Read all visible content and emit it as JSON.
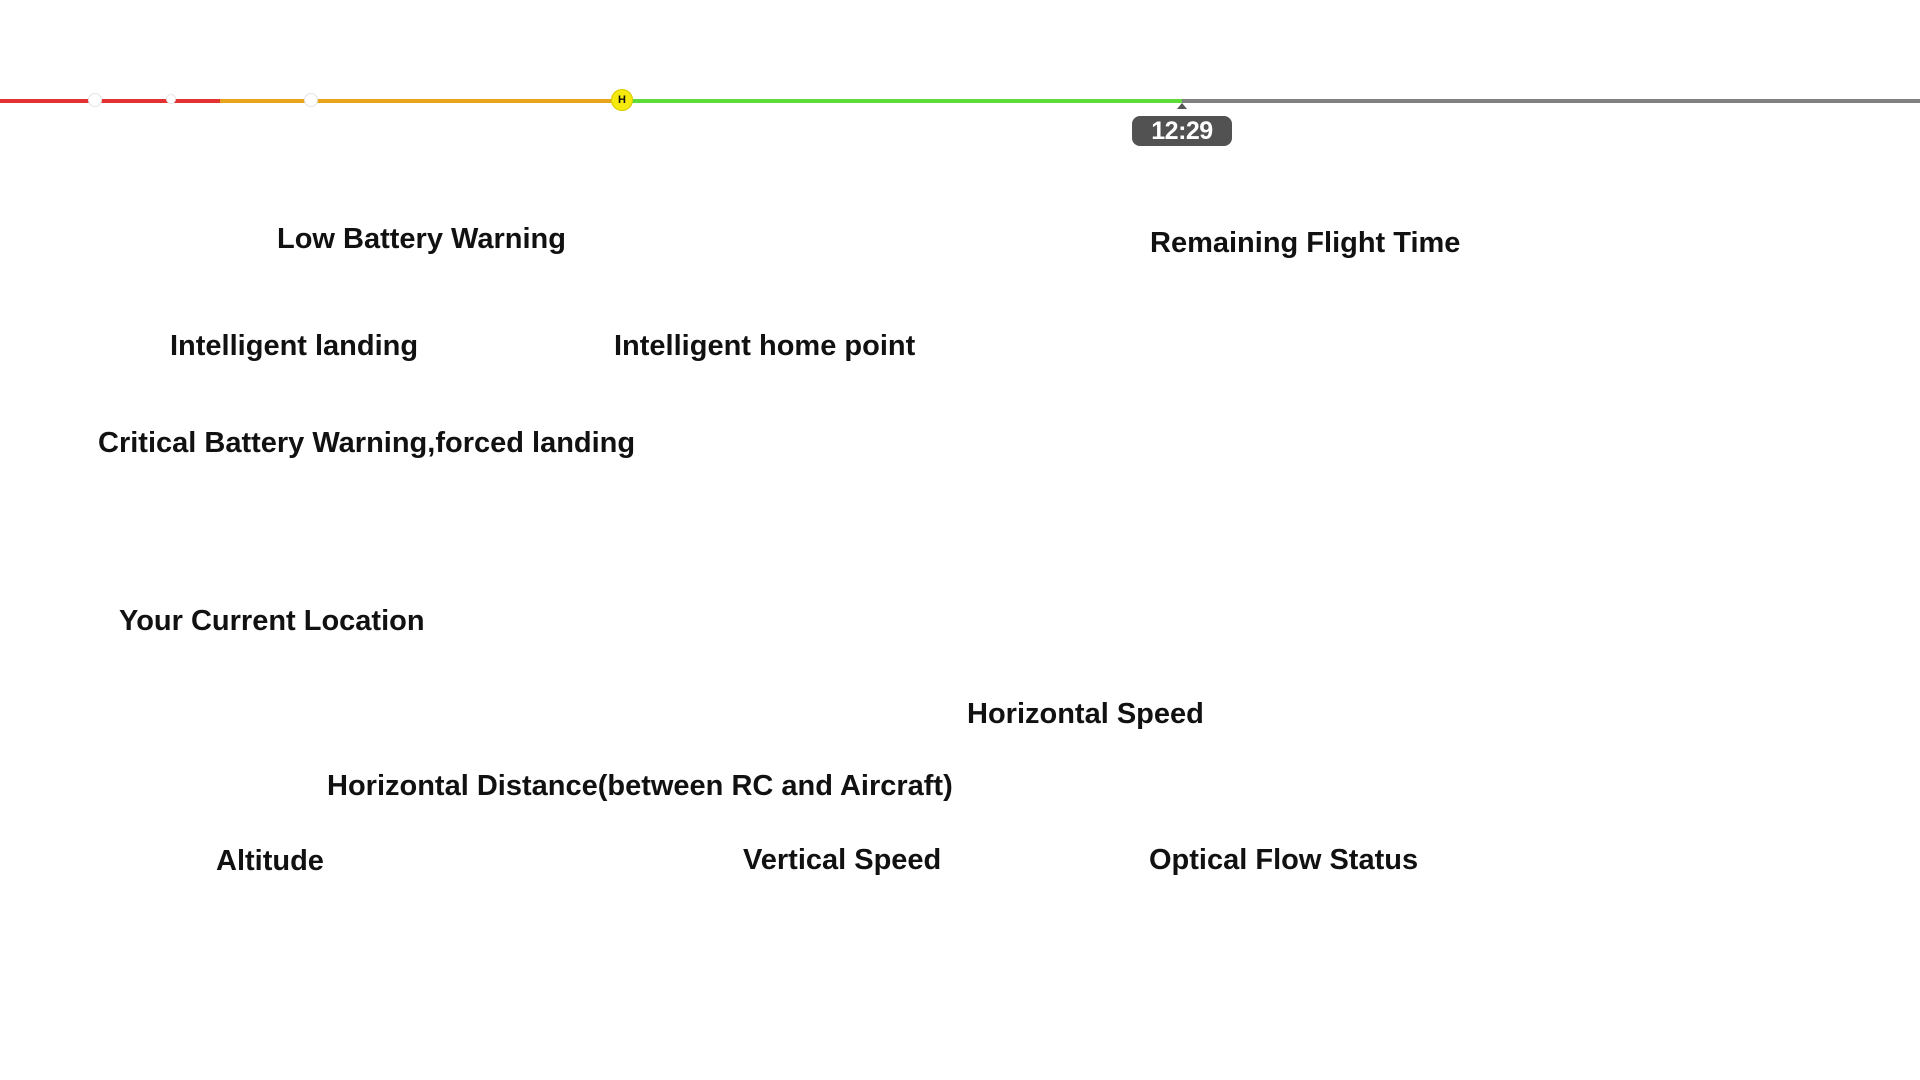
{
  "battery_bar": {
    "colors": {
      "critical": "#e23232",
      "low": "#e8a51c",
      "normal": "#5ddc3a",
      "remaining": "#808080",
      "home_marker": "#f5ea0b"
    },
    "home_marker_label": "H",
    "remaining_time": "12:29"
  },
  "labels": {
    "low_battery_warning": "Low Battery Warning",
    "remaining_flight_time": "Remaining Flight Time",
    "intelligent_landing": "Intelligent landing",
    "intelligent_home_point": "Intelligent home point",
    "critical_battery_warning": "Critical Battery Warning,forced landing",
    "current_location": "Your Current Location",
    "horizontal_speed": "Horizontal Speed",
    "horizontal_distance": "Horizontal Distance(between RC and Aircraft)",
    "altitude": "Altitude",
    "vertical_speed": "Vertical Speed",
    "optical_flow_status": "Optical Flow Status"
  }
}
